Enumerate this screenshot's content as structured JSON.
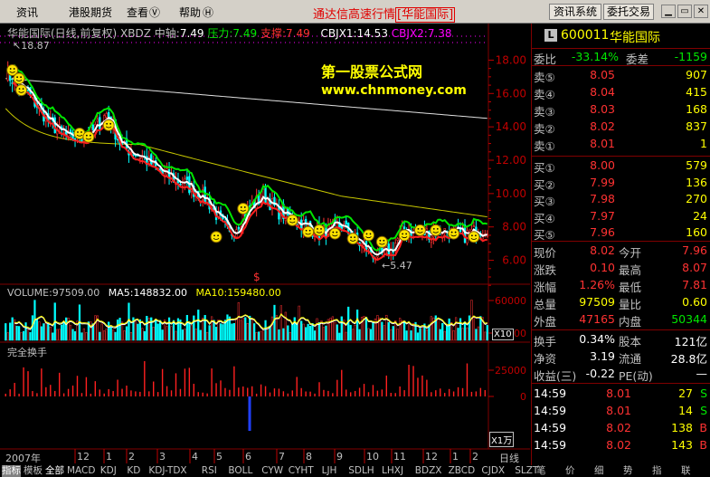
{
  "menubar": {
    "items": [
      "资讯",
      "港股期货",
      "查看",
      "帮助"
    ],
    "title": "通达信高速行情",
    "broker": "[华能国际]",
    "btn_info": "资讯系统",
    "btn_order": "委托交易"
  },
  "chart": {
    "header": {
      "name": "华能国际(日线,前复权)",
      "indicator": "XBDZ",
      "zhongzhou_label": "中轴:",
      "zhongzhou": "7.49",
      "yali_label": "压力:",
      "yali": "7.49",
      "zhicheng_label": "支撑:",
      "zhicheng": "7.49",
      "cbjx1": "CBJX1:14.53",
      "cbjx2": "CBJX2:7.38"
    },
    "watermark1": "第一股票公式网",
    "watermark2": "www.chnmoney.com",
    "high_label": "18.87",
    "low_label": "5.47",
    "dollar": "$",
    "price_ticks": [
      "18.00",
      "16.00",
      "14.00",
      "12.00",
      "10.00",
      "8.00",
      "6.00"
    ],
    "volume": {
      "header": "VOLUME:97509.00",
      "ma5": "MA5:148832.00",
      "ma10": "MA10:159480.00",
      "ticks": [
        "60000",
        "20000"
      ],
      "unit": "X10"
    },
    "turnover": {
      "header": "完全换手",
      "ticks": [
        "25000",
        "0"
      ],
      "unit": "X1万"
    },
    "xaxis": {
      "year": "2007年",
      "labels": [
        "12",
        "1",
        "2",
        "3",
        "4",
        "5",
        "6",
        "7",
        "8",
        "9",
        "10",
        "11",
        "12",
        "1",
        "2"
      ],
      "period": "日线"
    }
  },
  "chart_data": {
    "type": "candlestick",
    "ylim": [
      5,
      19
    ],
    "high": 18.87,
    "low": 5.47,
    "price_ticks": [
      18,
      16,
      14,
      12,
      10,
      8,
      6
    ],
    "volume_ticks": [
      60000,
      20000
    ],
    "turnover_ticks": [
      25000,
      0
    ]
  },
  "quote": {
    "code": "600011",
    "name": "华能国际",
    "badge": "L",
    "weibi_label": "委比",
    "weibi": "-33.14%",
    "weicha_label": "委差",
    "weicha": "-1159",
    "sells": [
      {
        "label": "卖⑤",
        "price": "8.05",
        "vol": "907"
      },
      {
        "label": "卖④",
        "price": "8.04",
        "vol": "415"
      },
      {
        "label": "卖③",
        "price": "8.03",
        "vol": "168"
      },
      {
        "label": "卖②",
        "price": "8.02",
        "vol": "837"
      },
      {
        "label": "卖①",
        "price": "8.01",
        "vol": "1"
      }
    ],
    "buys": [
      {
        "label": "买①",
        "price": "8.00",
        "vol": "579"
      },
      {
        "label": "买②",
        "price": "7.99",
        "vol": "136"
      },
      {
        "label": "买③",
        "price": "7.98",
        "vol": "270"
      },
      {
        "label": "买④",
        "price": "7.97",
        "vol": "24"
      },
      {
        "label": "买⑤",
        "price": "7.96",
        "vol": "160"
      }
    ],
    "stats": [
      {
        "l1": "现价",
        "v1": "8.02",
        "l2": "今开",
        "v2": "7.96"
      },
      {
        "l1": "涨跌",
        "v1": "0.10",
        "l2": "最高",
        "v2": "8.07"
      },
      {
        "l1": "涨幅",
        "v1": "1.26%",
        "l2": "最低",
        "v2": "7.81"
      },
      {
        "l1": "总量",
        "v1": "97509",
        "l2": "量比",
        "v2": "0.60"
      },
      {
        "l1": "外盘",
        "v1": "47165",
        "l2": "内盘",
        "v2": "50344"
      }
    ],
    "stats2": [
      {
        "l1": "换手",
        "v1": "0.34%",
        "l2": "股本",
        "v2": "121亿"
      },
      {
        "l1": "净资",
        "v1": "3.19",
        "l2": "流通",
        "v2": "28.8亿"
      },
      {
        "l1": "收益(三)",
        "v1": "-0.22",
        "l2": "PE(动)",
        "v2": "—"
      }
    ],
    "ticks": [
      {
        "t": "14:59",
        "p": "8.01",
        "v": "27",
        "s": "S"
      },
      {
        "t": "14:59",
        "p": "8.01",
        "v": "14",
        "s": "S"
      },
      {
        "t": "14:59",
        "p": "8.02",
        "v": "138",
        "s": "B"
      },
      {
        "t": "14:59",
        "p": "8.02",
        "v": "143",
        "s": "B"
      }
    ]
  },
  "tabs": [
    "指标",
    "模板",
    "全部",
    "MACD",
    "KDJ",
    "KD",
    "KDJ-TDX",
    "RSI",
    "BOLL",
    "CYW",
    "CYHT",
    "LJH",
    "SDLH",
    "LHXJ",
    "BDZX",
    "ZBCD",
    "CJDX",
    "SLZT"
  ],
  "rtabs": [
    "笔",
    "价",
    "细",
    "势",
    "指",
    "联"
  ],
  "colors": {
    "up": "#ff3232",
    "down": "#00ffff",
    "ma_white": "#ffffff",
    "ma_green": "#00e600",
    "ma_yellow": "#c8c800"
  }
}
